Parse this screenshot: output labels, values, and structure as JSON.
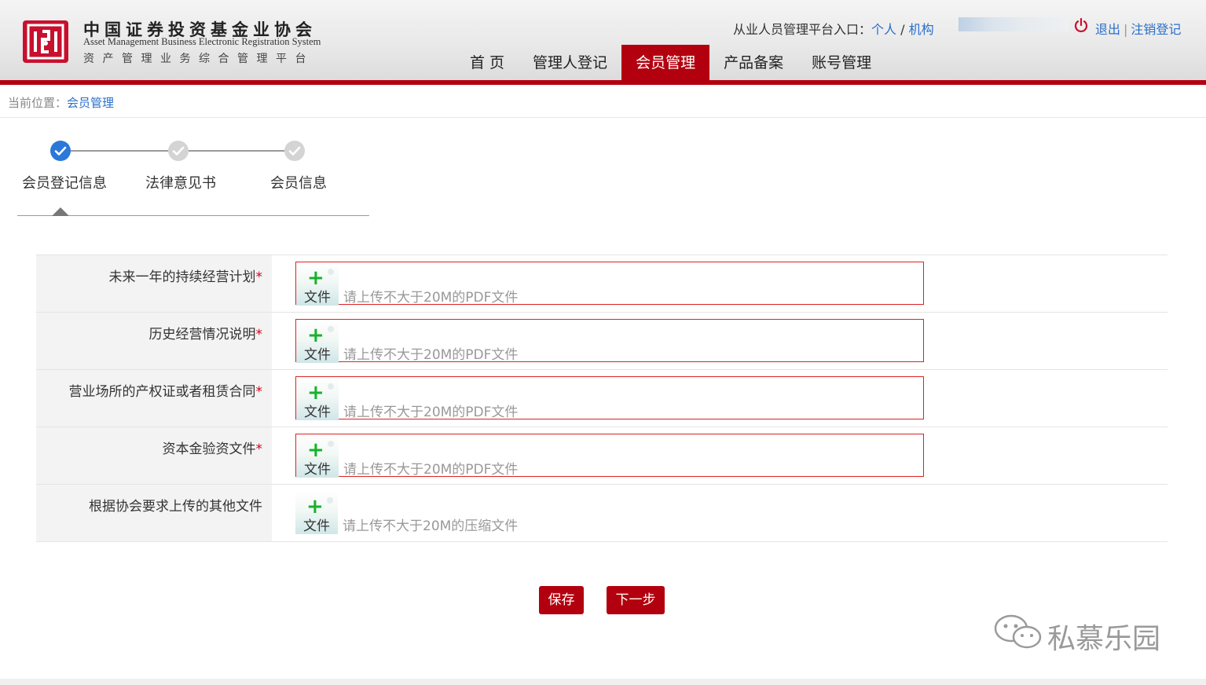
{
  "header": {
    "org_name_cn": "中国证券投资基金业协会",
    "system_name_en": "Asset Management Business Electronic Registration System",
    "system_name_cn": "资产管理业务综合管理平台",
    "portal_prefix": "从业人员管理平台入口：",
    "portal_individual": "个人",
    "portal_sep": " / ",
    "portal_institution": "机构",
    "logout_label": "退出",
    "logout_sep": "|",
    "cancel_registration_label": "注销登记",
    "brand_color": "#b3000f"
  },
  "nav": {
    "home": "首 页",
    "manager_registration": "管理人登记",
    "membership": "会员管理",
    "product_filing": "产品备案",
    "account_management": "账号管理",
    "active": "会员管理"
  },
  "breadcrumb": {
    "prefix": "当前位置：",
    "current": "会员管理"
  },
  "steps": {
    "current_index": 0,
    "items": [
      {
        "label": "会员登记信息",
        "status": "done"
      },
      {
        "label": "法律意见书",
        "status": "todo"
      },
      {
        "label": "会员信息",
        "status": "todo"
      }
    ]
  },
  "form": {
    "add_file_label": "文件",
    "required_mark": "*",
    "rows": [
      {
        "label": "未来一年的持续经营计划",
        "required": true,
        "hint": "请上传不大于20M的PDF文件"
      },
      {
        "label": "历史经营情况说明",
        "required": true,
        "hint": "请上传不大于20M的PDF文件"
      },
      {
        "label": "营业场所的产权证或者租赁合同",
        "required": true,
        "hint": "请上传不大于20M的PDF文件"
      },
      {
        "label": "资本金验资文件",
        "required": true,
        "hint": "请上传不大于20M的PDF文件"
      },
      {
        "label": "根据协会要求上传的其他文件",
        "required": false,
        "hint": "请上传不大于20M的压缩文件"
      }
    ]
  },
  "actions": {
    "save_label": "保存",
    "next_label": "下一步"
  },
  "watermark": {
    "text": "私慕乐园"
  }
}
